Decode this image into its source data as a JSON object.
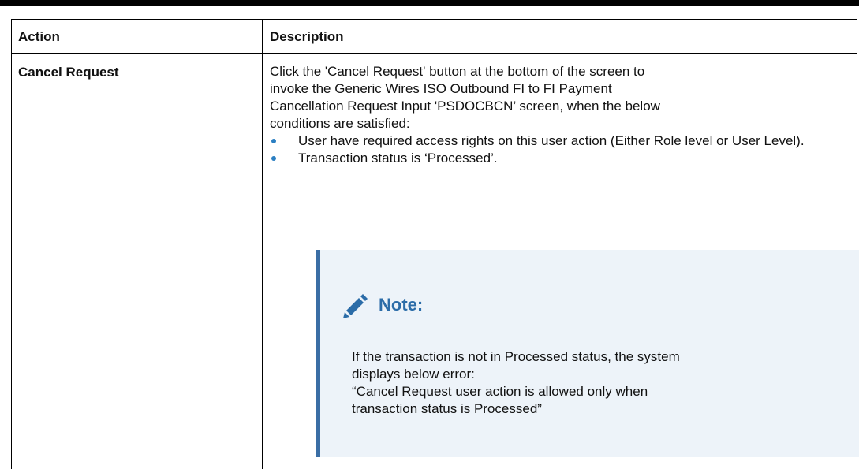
{
  "table": {
    "headers": {
      "action": "Action",
      "description": "Description"
    },
    "rows": [
      {
        "action": "Cancel Request",
        "description": {
          "intro_lines": [
            "Click the 'Cancel Request' button at the bottom of the screen to",
            "invoke the Generic Wires ISO Outbound FI to FI Payment",
            "Cancellation Request Input 'PSDOCBCN’ screen, when the below",
            "conditions are satisfied:"
          ],
          "bullets": [
            "User have required access rights on this user action (Either Role level or User Level).",
            "Transaction status is ‘Processed’."
          ],
          "note": {
            "icon": "pencil-icon",
            "title": "Note:",
            "lines": [
              "If the transaction is not in Processed status, the system",
              "displays below error:",
              "“Cancel Request user action is allowed only when",
              "transaction status is Processed”"
            ]
          }
        }
      }
    ]
  },
  "colors": {
    "bullet": "#2b7fc2",
    "note_title": "#2b6ca8",
    "note_border": "#3a6ea5",
    "note_background": "#edf3f9"
  }
}
